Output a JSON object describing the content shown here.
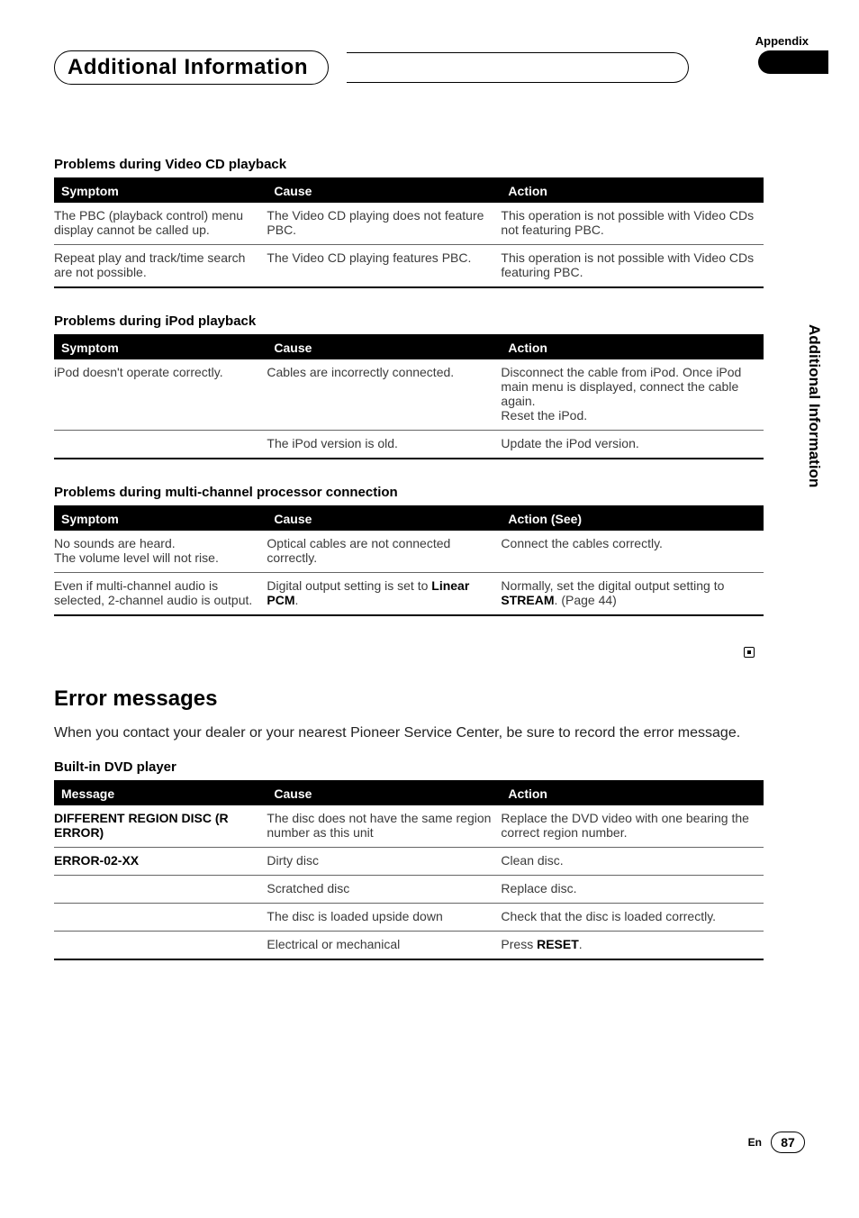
{
  "header": {
    "appendix": "Appendix",
    "title": "Additional Information"
  },
  "side": {
    "label": "Additional Information"
  },
  "sections": [
    {
      "title": "Problems during Video CD playback",
      "headers": [
        "Symptom",
        "Cause",
        "Action"
      ],
      "rows": [
        {
          "c1": "The PBC (playback control) menu display cannot be called up.",
          "c2": "The Video CD playing does not feature PBC.",
          "c3": "This operation is not possible with Video CDs not featuring PBC."
        },
        {
          "c1": "Repeat play and track/time search are not possible.",
          "c2": "The Video CD playing features PBC.",
          "c3": "This operation is not possible with Video CDs featuring PBC."
        }
      ]
    },
    {
      "title": "Problems during iPod playback",
      "headers": [
        "Symptom",
        "Cause",
        "Action"
      ],
      "rows": [
        {
          "c1": "iPod doesn't operate correctly.",
          "c2": "Cables are incorrectly connected.",
          "c3": "Disconnect the cable from iPod. Once iPod main menu is displayed, connect the cable again.\nReset the iPod."
        },
        {
          "c1": "",
          "c2": "The iPod version is old.",
          "c3": "Update the iPod version."
        }
      ]
    },
    {
      "title": "Problems during multi-channel processor connection",
      "headers": [
        "Symptom",
        "Cause",
        "Action (See)"
      ],
      "rows": [
        {
          "c1": "No sounds are heard.\nThe volume level will not rise.",
          "c2": "Optical cables are not connected correctly.",
          "c3": "Connect the cables correctly."
        },
        {
          "c1": "Even if multi-channel audio is selected, 2-channel audio is output.",
          "c2_pre": "Digital output setting is set to ",
          "c2_b": "Linear PCM",
          "c2_post": ".",
          "c3_pre": "Normally, set the digital output setting to ",
          "c3_b": "STREAM",
          "c3_post": ". (Page 44)"
        }
      ]
    }
  ],
  "error": {
    "heading": "Error messages",
    "intro": "When you contact your dealer or your nearest Pioneer Service Center, be sure to record the error message.",
    "subtitle": "Built-in DVD player",
    "headers": [
      "Message",
      "Cause",
      "Action"
    ],
    "rows": [
      {
        "m": "DIFFERENT REGION DISC (R ERROR)",
        "c": "The disc does not have the same region number as this unit",
        "a": "Replace the DVD video with one bearing the correct region number."
      },
      {
        "m": "ERROR-02-XX",
        "c": "Dirty disc",
        "a": "Clean disc."
      },
      {
        "m": "",
        "c": "Scratched disc",
        "a": "Replace disc."
      },
      {
        "m": "",
        "c": "The disc is loaded upside down",
        "a": "Check that the disc is loaded correctly."
      },
      {
        "m": "",
        "c": "Electrical or mechanical",
        "a_pre": "Press ",
        "a_b": "RESET",
        "a_post": "."
      }
    ]
  },
  "footer": {
    "lang": "En",
    "page": "87"
  }
}
